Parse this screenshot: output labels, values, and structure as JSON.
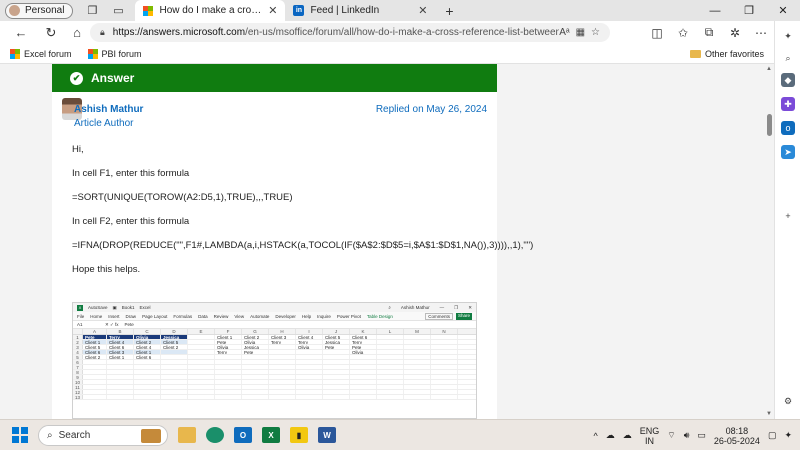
{
  "browser": {
    "profile_label": "Personal",
    "tabs": [
      {
        "title": "How do I make a cross reference list between tea",
        "active": true
      },
      {
        "title": "Feed | LinkedIn",
        "active": false
      }
    ],
    "url_host": "https://answers.microsoft.com",
    "url_path": "/en-us/msoffice/forum/all/how-do-i-make-a-cross-reference-list-between-team...",
    "bookmarks": [
      "Excel forum",
      "PBI forum"
    ],
    "other_favorites": "Other favorites"
  },
  "answer": {
    "header": "Answer",
    "author_name": "Ashish Mathur",
    "author_role": "Article Author",
    "replied": "Replied on May 26, 2024",
    "paragraphs": [
      "Hi,",
      "In cell F1, enter this formula",
      "=SORT(UNIQUE(TOROW(A2:D5,1),TRUE),,,TRUE)",
      "In cell F2, enter this formula",
      "=IFNA(DROP(REDUCE(\"\",F1#,LAMBDA(a,i,HSTACK(a,TOCOL(IF($A$2:$D$5=i,$A$1:$D$1,NA()),3)))),,1),\"\")",
      "Hope this helps."
    ]
  },
  "excel": {
    "title_items": [
      "AutoSave",
      "Book1",
      "Excel"
    ],
    "user": "Ashish Mathur",
    "menu": [
      "File",
      "Home",
      "Insert",
      "Draw",
      "Page Layout",
      "Formulas",
      "Data",
      "Review",
      "View",
      "Automate",
      "Developer",
      "Help",
      "Inquire",
      "Power Pivot",
      "Table Design"
    ],
    "comments": "Comments",
    "share": "Share",
    "name_box": "A1",
    "formula": "Pete",
    "columns": [
      "A",
      "B",
      "C",
      "D",
      "E",
      "F",
      "G",
      "H",
      "I",
      "J",
      "K",
      "L",
      "M",
      "N"
    ],
    "rows": [
      [
        "Pete",
        "Terry",
        "Olivia",
        "Jessica",
        "",
        "Client 1",
        "Client 2",
        "Client 3",
        "Client 4",
        "Client 5",
        "Client 6",
        "",
        "",
        ""
      ],
      [
        "Client 1",
        "Client 4",
        "Client 2",
        "Client 5",
        "",
        "Pete",
        "Olivia",
        "Terry",
        "Terry",
        "Jessica",
        "Terry",
        "",
        "",
        ""
      ],
      [
        "Client 5",
        "Client 6",
        "Client 4",
        "Client 2",
        "",
        "Olivia",
        "Jessica",
        "",
        "Olivia",
        "Pete",
        "Pete",
        "",
        "",
        ""
      ],
      [
        "Client 6",
        "Client 3",
        "Client 1",
        "",
        "",
        "Terry",
        "Pete",
        "",
        "",
        "",
        "Olivia",
        "",
        "",
        ""
      ],
      [
        "Client 2",
        "Client 1",
        "Client 6",
        "",
        "",
        "",
        "",
        "",
        "",
        "",
        "",
        "",
        "",
        ""
      ],
      [
        "",
        "",
        "",
        "",
        "",
        "",
        "",
        "",
        "",
        "",
        "",
        "",
        "",
        ""
      ],
      [
        "",
        "",
        "",
        "",
        "",
        "",
        "",
        "",
        "",
        "",
        "",
        "",
        "",
        ""
      ],
      [
        "",
        "",
        "",
        "",
        "",
        "",
        "",
        "",
        "",
        "",
        "",
        "",
        "",
        ""
      ],
      [
        "",
        "",
        "",
        "",
        "",
        "",
        "",
        "",
        "",
        "",
        "",
        "",
        "",
        ""
      ],
      [
        "",
        "",
        "",
        "",
        "",
        "",
        "",
        "",
        "",
        "",
        "",
        "",
        "",
        ""
      ],
      [
        "",
        "",
        "",
        "",
        "",
        "",
        "",
        "",
        "",
        "",
        "",
        "",
        "",
        ""
      ],
      [
        "",
        "",
        "",
        "",
        "",
        "",
        "",
        "",
        "",
        "",
        "",
        "",
        "",
        ""
      ],
      [
        "",
        "",
        "",
        "",
        "",
        "",
        "",
        "",
        "",
        "",
        "",
        "",
        "",
        ""
      ]
    ]
  },
  "taskbar": {
    "search_label": "Search",
    "lang_top": "ENG",
    "lang_bottom": "IN",
    "time": "08:18",
    "date": "26-05-2024"
  },
  "colors": {
    "answer_green": "#107c10",
    "link_blue": "#0f6cbd",
    "excel_green": "#107c41"
  }
}
